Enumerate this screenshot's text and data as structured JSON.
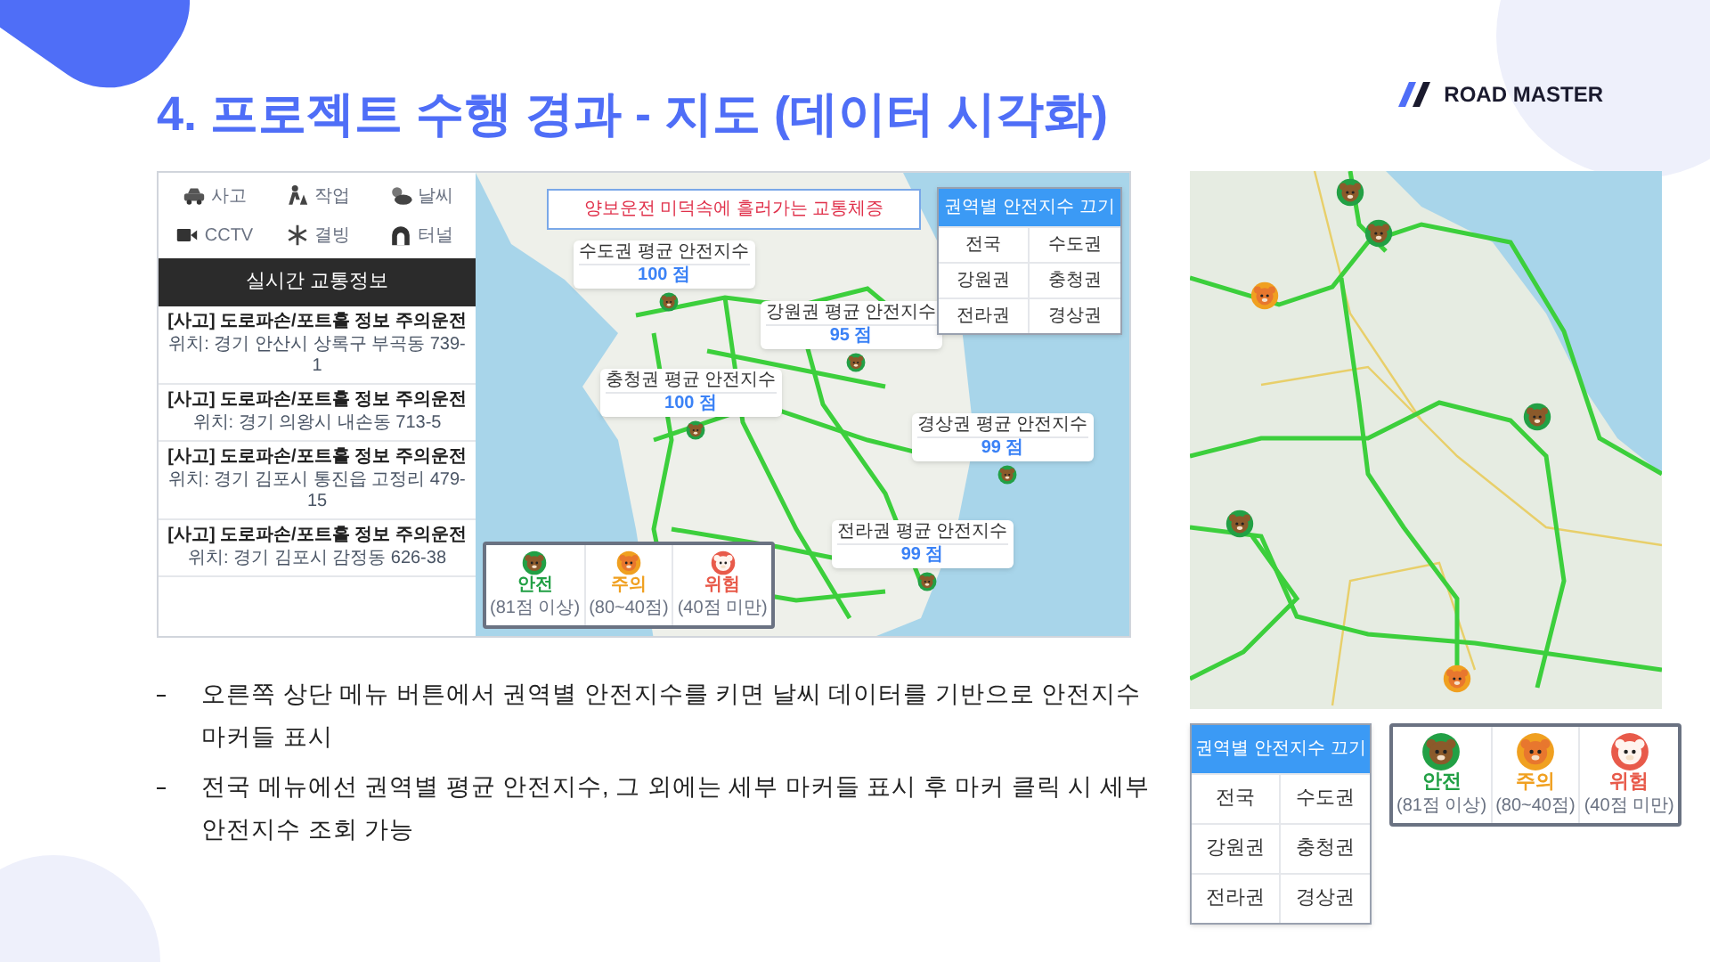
{
  "slide_title": "4. 프로젝트 수행 경과 - 지도 (데이터 시각화)",
  "logo": "ROAD MASTER",
  "app": {
    "categories": [
      {
        "kind": "accident",
        "label": "사고"
      },
      {
        "kind": "work",
        "label": "작업"
      },
      {
        "kind": "weather",
        "label": "날씨"
      },
      {
        "kind": "cctv",
        "label": "CCTV"
      },
      {
        "kind": "ice",
        "label": "결빙"
      },
      {
        "kind": "tunnel",
        "label": "터널"
      }
    ],
    "sidebar_title": "실시간 교통정보",
    "items": [
      {
        "title": "[사고] 도로파손/포트홀 정보 주의운전",
        "location": "위치: 경기 안산시 상록구 부곡동 739-1"
      },
      {
        "title": "[사고] 도로파손/포트홀 정보 주의운전",
        "location": "위치: 경기 의왕시 내손동 713-5"
      },
      {
        "title": "[사고] 도로파손/포트홀 정보 주의운전",
        "location": "위치: 경기 김포시 통진읍 고정리 479-15"
      },
      {
        "title": "[사고] 도로파손/포트홀 정보 주의운전",
        "location": "위치: 경기 김포시 감정동 626-38"
      }
    ],
    "banner": "양보운전 미덕속에 흘러가는 교통체증",
    "region_cards": [
      {
        "label": "수도권 평균 안전지수",
        "score": "100 점",
        "kind": "safe"
      },
      {
        "label": "강원권 평균 안전지수",
        "score": "95 점",
        "kind": "safe"
      },
      {
        "label": "충청권 평균 안전지수",
        "score": "100 점",
        "kind": "safe"
      },
      {
        "label": "경상권 평균 안전지수",
        "score": "99 점",
        "kind": "safe"
      },
      {
        "label": "전라권 평균 안전지수",
        "score": "99 점",
        "kind": "safe"
      }
    ],
    "menu": {
      "header": "권역별 안전지수 끄기",
      "options": [
        "전국",
        "수도권",
        "강원권",
        "충청권",
        "전라권",
        "경상권"
      ]
    },
    "legend": [
      {
        "kind": "safe",
        "label": "안전",
        "range": "(81점 이상)"
      },
      {
        "kind": "caution",
        "label": "주의",
        "range": "(80~40점)"
      },
      {
        "kind": "danger",
        "label": "위험",
        "range": "(40점 미만)"
      }
    ]
  },
  "detail_map": {
    "markers": [
      {
        "kind": "safe"
      },
      {
        "kind": "safe"
      },
      {
        "kind": "caution"
      },
      {
        "kind": "safe"
      },
      {
        "kind": "safe"
      },
      {
        "kind": "caution"
      }
    ]
  },
  "detail_menu": {
    "header": "권역별 안전지수 끄기",
    "options": [
      "전국",
      "수도권",
      "강원권",
      "충청권",
      "전라권",
      "경상권"
    ]
  },
  "detail_legend": [
    {
      "kind": "safe",
      "label": "안전",
      "range": "(81점 이상)"
    },
    {
      "kind": "caution",
      "label": "주의",
      "range": "(80~40점)"
    },
    {
      "kind": "danger",
      "label": "위험",
      "range": "(40점 미만)"
    }
  ],
  "bullets": [
    "오른쪽 상단 메뉴 버튼에서 권역별 안전지수를 키면 날씨 데이터를 기반으로 안전지수 마커들 표시",
    "전국 메뉴에선 권역별 평균 안전지수, 그 외에는 세부 마커들 표시 후 마커 클릭 시 세부 안전지수 조회 가능"
  ]
}
